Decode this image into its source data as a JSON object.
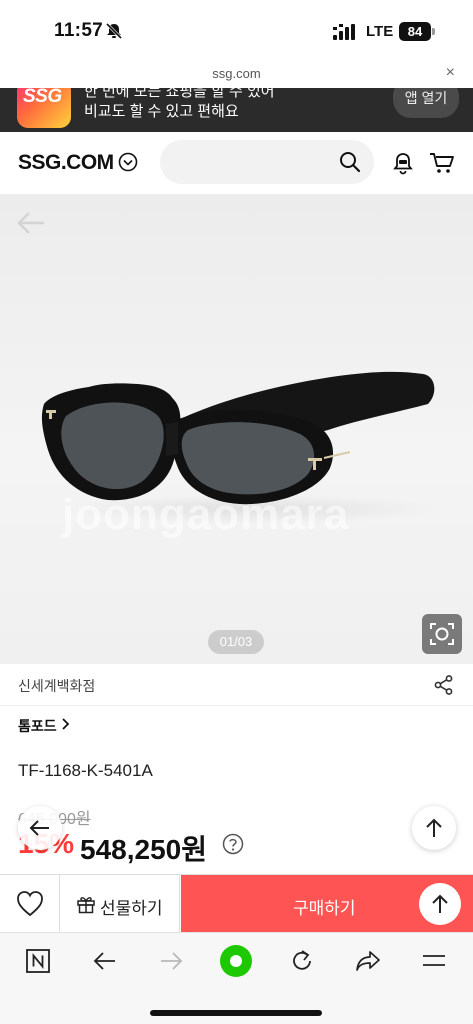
{
  "status_bar": {
    "time": "11:57",
    "network": "LTE",
    "battery": "84"
  },
  "browser": {
    "url": "ssg.com",
    "close_symbol": "×"
  },
  "app_banner": {
    "logo_text": "SSG",
    "line1": "한 번에 모든 쇼핑을 할 수 있어",
    "line2": "비교도 할 수 있고 편해요",
    "open_label": "앱 열기"
  },
  "header": {
    "logo": "SSG.COM",
    "search_placeholder": ""
  },
  "gallery": {
    "counter": "01/03",
    "watermark": "joongaomara"
  },
  "seller": {
    "name": "신세계백화점"
  },
  "product": {
    "brand": "톰포드",
    "title": "TF-1168-K-5401A",
    "original_price": "645,000원",
    "discount": "15%",
    "price": "548,250원"
  },
  "actions": {
    "gift_label": "선물하기",
    "buy_label": "구매하기"
  },
  "colors": {
    "accent": "#ff5454",
    "discount": "#ff3b3b",
    "banner_bg": "#2b2b2b",
    "pill_green": "#1ec800"
  },
  "icons": [
    "bell-off-icon",
    "signal-icon",
    "battery-icon",
    "chevron-down-icon",
    "search-icon",
    "notification-bell-icon",
    "cart-icon",
    "back-arrow-icon",
    "camera-zoom-icon",
    "share-icon",
    "chevron-right-icon",
    "help-icon",
    "arrow-up-icon",
    "heart-icon",
    "gift-icon",
    "naver-n-icon",
    "forward-arrow-icon",
    "green-dot-icon",
    "reload-icon",
    "share-arrow-icon",
    "menu-icon"
  ]
}
